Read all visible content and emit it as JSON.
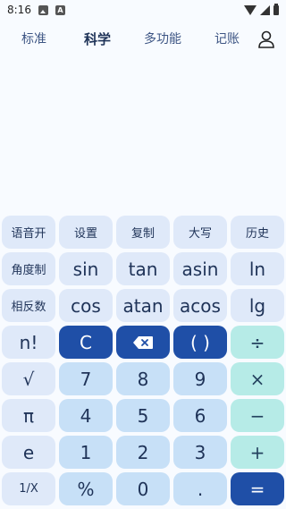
{
  "status": {
    "time": "8:16"
  },
  "nav": {
    "tabs": [
      {
        "label": "标准"
      },
      {
        "label": "科学"
      },
      {
        "label": "多功能"
      },
      {
        "label": "记账"
      }
    ]
  },
  "display": {
    "expression": "",
    "result": ""
  },
  "keys": {
    "voice": "语音开",
    "settings": "设置",
    "copy": "复制",
    "uppercase": "大写",
    "history": "历史",
    "angle": "角度制",
    "sin": "sin",
    "tan": "tan",
    "asin": "asin",
    "ln": "ln",
    "inverse": "相反数",
    "cos": "cos",
    "atan": "atan",
    "acos": "acos",
    "lg": "lg",
    "factorial": "n!",
    "clear": "C",
    "parens": "( )",
    "divide": "÷",
    "sqrt": "√",
    "seven": "7",
    "eight": "8",
    "nine": "9",
    "multiply": "×",
    "pi": "π",
    "four": "4",
    "five": "5",
    "six": "6",
    "minus": "−",
    "e": "e",
    "one": "1",
    "two": "2",
    "three": "3",
    "plus": "+",
    "reciprocal": "1/X",
    "percent": "%",
    "zero": "0",
    "dot": ".",
    "equals": "="
  }
}
